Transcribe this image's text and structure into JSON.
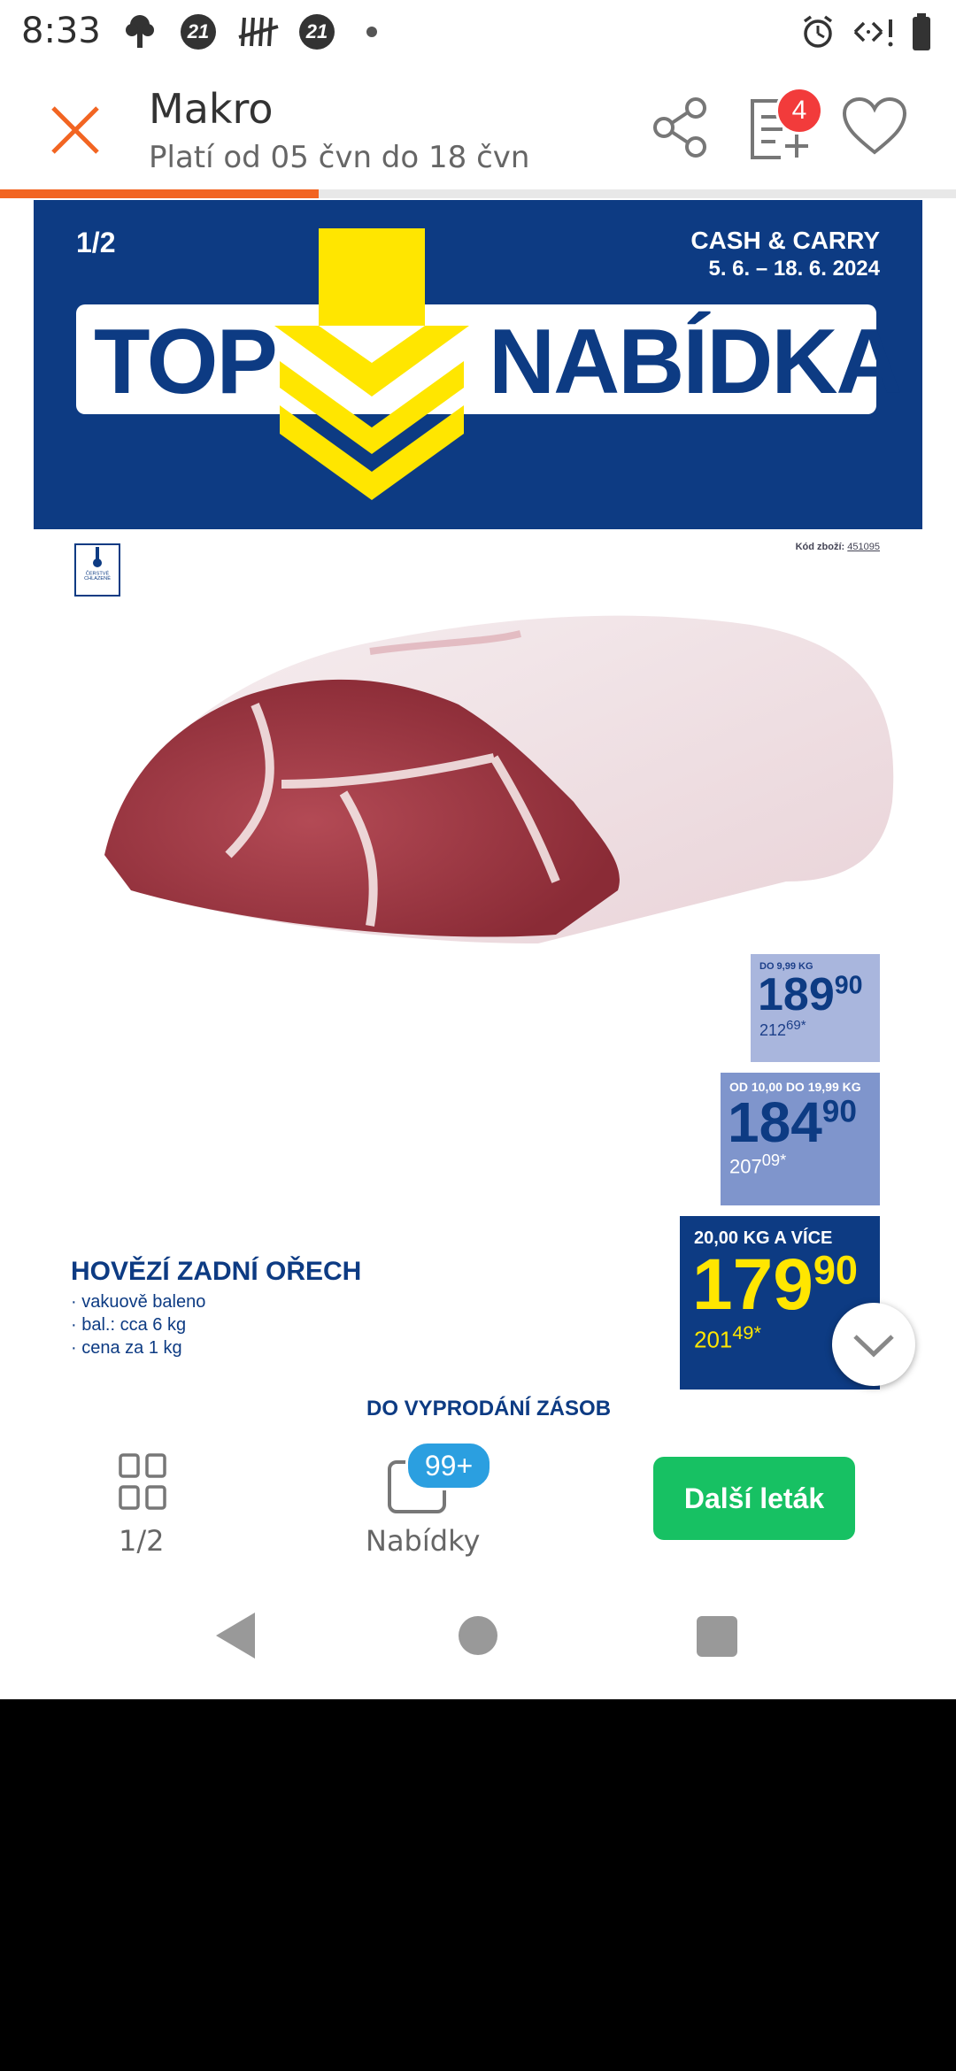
{
  "status_bar": {
    "time": "8:33",
    "notif_badge_1": "21",
    "notif_badge_2": "21",
    "icons": [
      "tree-icon",
      "tally-icon",
      "alarm-icon",
      "data-arrows-icon",
      "battery-icon"
    ]
  },
  "header": {
    "title": "Makro",
    "subtitle": "Platí od 05 čvn do 18 čvn",
    "cart_count": "4",
    "accent_color": "#f26522",
    "progress_fraction": 0.333
  },
  "leaflet": {
    "page_indicator": "1/2",
    "store_label": "CASH & CARRY",
    "date_range": "5. 6. – 18. 6. 2024",
    "headline_left": "TOP",
    "headline_right": "NABÍDKA",
    "badge_text": "ČERSTVÉ CHLAZENÉ",
    "product_code_label": "Kód zboží:",
    "product_code": "451095",
    "product_name": "HOVĚZÍ ZADNÍ OŘECH",
    "product_details": [
      "vakuově baleno",
      "bal.: cca 6 kg",
      "cena za 1 kg"
    ],
    "clearance_text": "DO VYPRODÁNÍ ZÁSOB",
    "price_tiers": [
      {
        "tier": "DO 9,99 KG",
        "price_main": "189",
        "price_cents": "90",
        "price_vat": "212",
        "price_vat_cents": "69*"
      },
      {
        "tier": "OD 10,00 DO 19,99 KG",
        "price_main": "184",
        "price_cents": "90",
        "price_vat": "207",
        "price_vat_cents": "09*"
      },
      {
        "tier": "20,00 KG A VÍCE",
        "price_main": "179",
        "price_cents": "90",
        "price_vat": "201",
        "price_vat_cents": "49*"
      }
    ]
  },
  "bottom_nav": {
    "pages_label": "1/2",
    "offers_label": "Nabídky",
    "offers_count": "99+",
    "next_button": "Další leták"
  }
}
